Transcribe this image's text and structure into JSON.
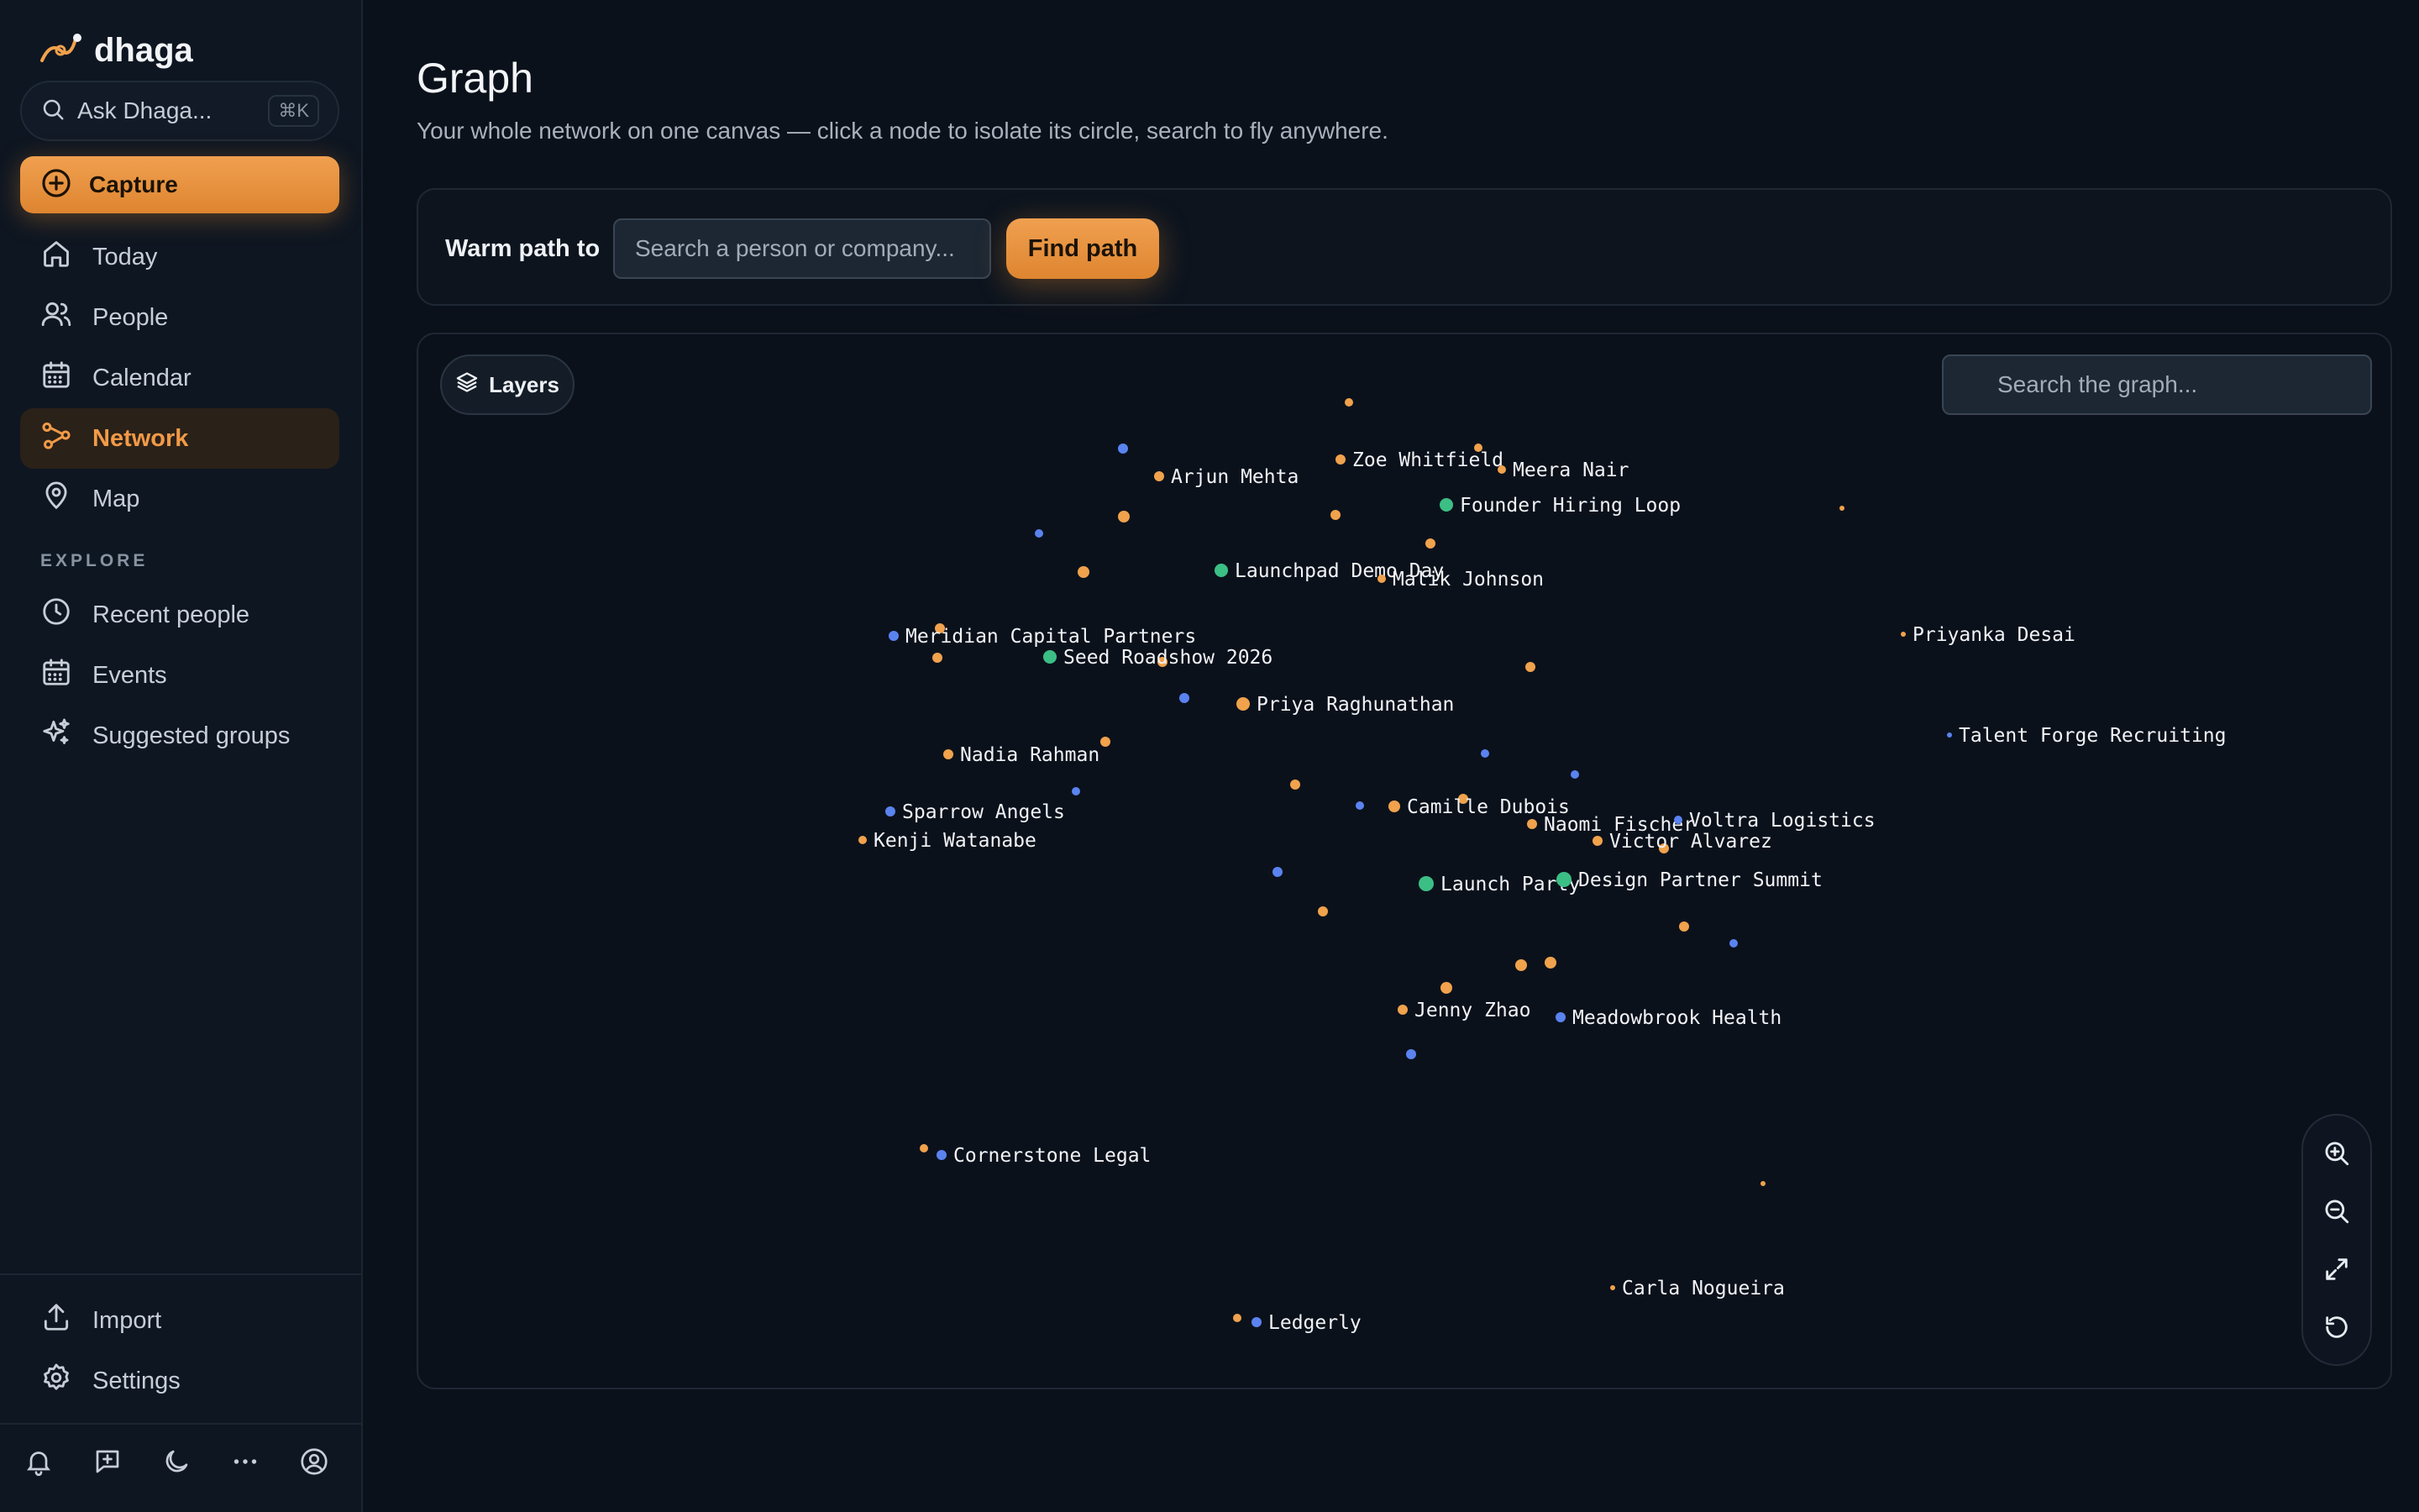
{
  "app": {
    "name": "dhaga"
  },
  "sidebar": {
    "ask": {
      "placeholder": "Ask Dhaga...",
      "shortcut": "⌘K"
    },
    "capture_label": "Capture",
    "nav": [
      {
        "label": "Today",
        "icon": "home-icon"
      },
      {
        "label": "People",
        "icon": "people-icon"
      },
      {
        "label": "Calendar",
        "icon": "calendar-icon"
      },
      {
        "label": "Network",
        "icon": "network-icon",
        "active": true
      },
      {
        "label": "Map",
        "icon": "map-pin-icon"
      }
    ],
    "explore_label": "EXPLORE",
    "explore": [
      {
        "label": "Recent people",
        "icon": "clock-icon"
      },
      {
        "label": "Events",
        "icon": "calendar-icon"
      },
      {
        "label": "Suggested groups",
        "icon": "sparkles-icon"
      }
    ],
    "footer": [
      {
        "label": "Import",
        "icon": "upload-icon"
      },
      {
        "label": "Settings",
        "icon": "gear-icon"
      }
    ],
    "bottom_icons": [
      "bell-icon",
      "chat-plus-icon",
      "moon-icon",
      "more-icon",
      "account-icon"
    ]
  },
  "main": {
    "title": "Graph",
    "subtitle": "Your whole network on one canvas — click a node to isolate its circle, search to fly anywhere.",
    "warm_path": {
      "label": "Warm path to",
      "placeholder": "Search a person or company...",
      "button": "Find path"
    },
    "graph": {
      "layers_label": "Layers",
      "search_placeholder": "Search the graph...",
      "zoom_controls": [
        "zoom-in-icon",
        "zoom-out-icon",
        "fit-screen-icon",
        "reset-icon"
      ],
      "colors": {
        "person": "#f0a24c",
        "company": "#5a83f0",
        "event": "#3bbf85"
      },
      "labeled_nodes": [
        {
          "label": "Arjun Mehta",
          "type": "person"
        },
        {
          "label": "Zoe Whitfield",
          "type": "person"
        },
        {
          "label": "Meera Nair",
          "type": "person"
        },
        {
          "label": "Founder Hiring Loop",
          "type": "event"
        },
        {
          "label": "Launchpad Demo Day",
          "type": "event"
        },
        {
          "label": "Malik Johnson",
          "type": "person"
        },
        {
          "label": "Meridian Capital Partners",
          "type": "company"
        },
        {
          "label": "Seed Roadshow 2026",
          "type": "event"
        },
        {
          "label": "Priyanka Desai",
          "type": "person"
        },
        {
          "label": "Priya Raghunathan",
          "type": "person"
        },
        {
          "label": "Talent Forge Recruiting",
          "type": "company"
        },
        {
          "label": "Nadia Rahman",
          "type": "person"
        },
        {
          "label": "Sparrow Angels",
          "type": "company"
        },
        {
          "label": "Kenji Watanabe",
          "type": "person"
        },
        {
          "label": "Camille Dubois",
          "type": "person"
        },
        {
          "label": "Naomi Fischer",
          "type": "person"
        },
        {
          "label": "Voltra Logistics",
          "type": "company"
        },
        {
          "label": "Victor Alvarez",
          "type": "person"
        },
        {
          "label": "Launch Party",
          "type": "event"
        },
        {
          "label": "Design Partner Summit",
          "type": "event"
        },
        {
          "label": "Jenny Zhao",
          "type": "person"
        },
        {
          "label": "Meadowbrook Health",
          "type": "company"
        },
        {
          "label": "Cornerstone Legal",
          "type": "company"
        },
        {
          "label": "Carla Nogueira",
          "type": "person"
        },
        {
          "label": "Ledgerly",
          "type": "company"
        }
      ]
    }
  }
}
